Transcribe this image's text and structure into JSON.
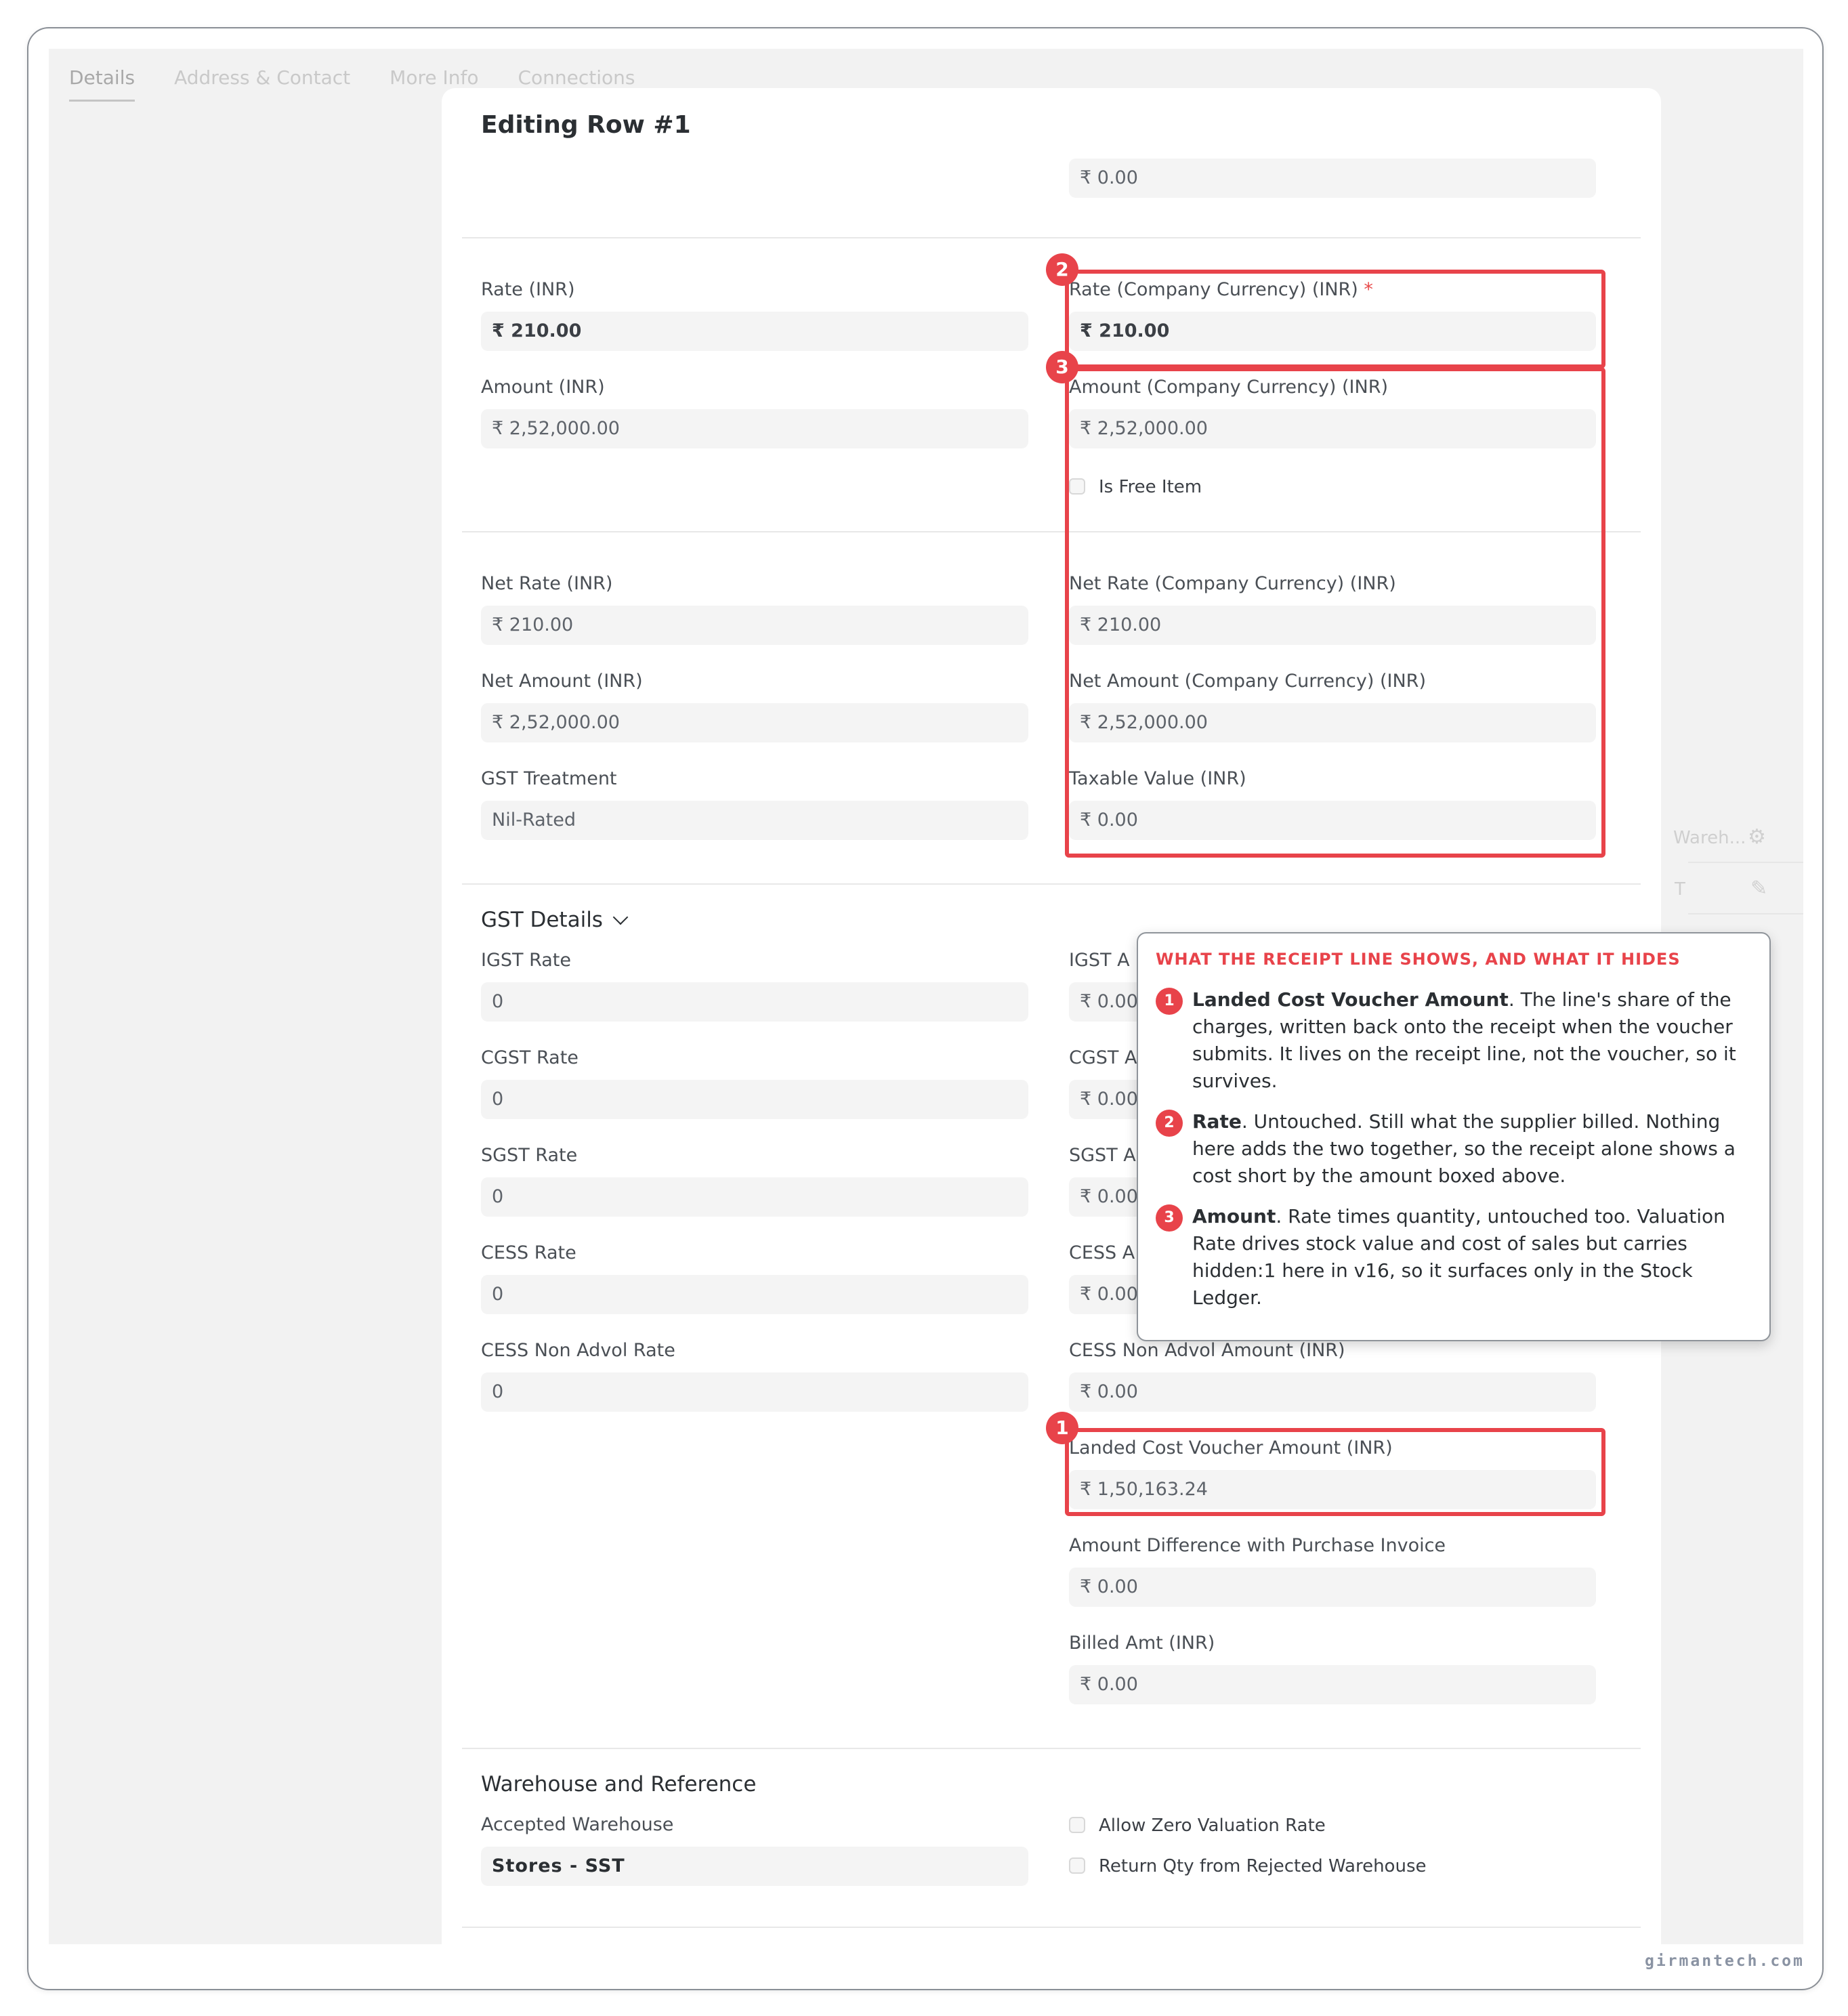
{
  "background": {
    "tabs": [
      "Details",
      "Address & Contact",
      "More Info",
      "Connections"
    ],
    "column_fragment": "Wareh...",
    "row_fragment": "T",
    "settings_icon": "gear-icon",
    "edit_icon": "pencil-icon"
  },
  "modal": {
    "title": "Editing Row #1",
    "top_value": "₹ 0.00",
    "rate": {
      "label": "Rate (INR)",
      "value": "₹ 210.00"
    },
    "rate_company": {
      "label": "Rate (Company Currency) (INR)",
      "required_mark": "*",
      "value": "₹ 210.00"
    },
    "amount": {
      "label": "Amount (INR)",
      "value": "₹ 2,52,000.00"
    },
    "amount_company": {
      "label": "Amount (Company Currency) (INR)",
      "value": "₹ 2,52,000.00"
    },
    "is_free_item": {
      "label": "Is Free Item",
      "checked": false
    },
    "net_rate": {
      "label": "Net Rate (INR)",
      "value": "₹ 210.00"
    },
    "net_rate_company": {
      "label": "Net Rate (Company Currency) (INR)",
      "value": "₹ 210.00"
    },
    "net_amount": {
      "label": "Net Amount (INR)",
      "value": "₹ 2,52,000.00"
    },
    "net_amount_company": {
      "label": "Net Amount (Company Currency) (INR)",
      "value": "₹ 2,52,000.00"
    },
    "gst_treatment": {
      "label": "GST Treatment",
      "value": "Nil-Rated"
    },
    "taxable_value": {
      "label": "Taxable Value (INR)",
      "value": "₹ 0.00"
    },
    "gst_section": "GST Details",
    "igst_rate": {
      "label": "IGST Rate",
      "value": "0"
    },
    "igst_amount": {
      "label": "IGST A",
      "value": "₹ 0.00"
    },
    "cgst_rate": {
      "label": "CGST Rate",
      "value": "0"
    },
    "cgst_amount": {
      "label": "CGST A",
      "value": "₹ 0.00"
    },
    "sgst_rate": {
      "label": "SGST Rate",
      "value": "0"
    },
    "sgst_amount": {
      "label": "SGST A",
      "value": "₹ 0.00"
    },
    "cess_rate": {
      "label": "CESS Rate",
      "value": "0"
    },
    "cess_amount": {
      "label": "CESS A",
      "value": "₹ 0.00"
    },
    "cess_non_advol_rate": {
      "label": "CESS Non Advol Rate",
      "value": "0"
    },
    "cess_non_advol_amount": {
      "label": "CESS Non Advol Amount (INR)",
      "value": "₹ 0.00"
    },
    "landed_cost": {
      "label": "Landed Cost Voucher Amount (INR)",
      "value": "₹ 1,50,163.24"
    },
    "amount_diff": {
      "label": "Amount Difference with Purchase Invoice",
      "value": "₹ 0.00"
    },
    "billed_amt": {
      "label": "Billed Amt (INR)",
      "value": "₹ 0.00"
    },
    "warehouse_section": "Warehouse and Reference",
    "accepted_warehouse": {
      "label": "Accepted Warehouse",
      "value": "Stores - SST"
    },
    "allow_zero_valuation": {
      "label": "Allow Zero Valuation Rate",
      "checked": false
    },
    "return_qty_rejected": {
      "label": "Return Qty from Rejected Warehouse",
      "checked": false
    }
  },
  "annotations": {
    "badges": [
      "1",
      "2",
      "3"
    ],
    "color": "#e8434a"
  },
  "callout": {
    "title": "WHAT THE RECEIPT LINE SHOWS, AND WHAT IT HIDES",
    "items": [
      {
        "num": "1",
        "term": "Landed Cost Voucher Amount",
        "text": ". The line's share of the charges, written back onto the receipt when the voucher submits. It lives on the receipt line, not the voucher, so it survives."
      },
      {
        "num": "2",
        "term": "Rate",
        "text": ". Untouched. Still what the supplier billed. Nothing here adds the two together, so the receipt alone shows a cost short by the amount boxed above."
      },
      {
        "num": "3",
        "term": "Amount",
        "text": ". Rate times quantity, untouched too. Valuation Rate drives stock value and cost of sales but carries hidden:1 here in v16, so it surfaces only in the Stock Ledger."
      }
    ]
  },
  "footer": "girmantech.com"
}
